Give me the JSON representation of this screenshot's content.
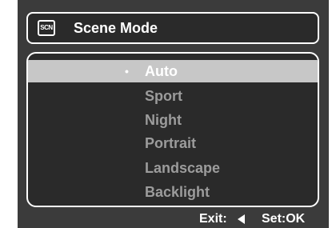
{
  "header": {
    "icon_text": "SCN",
    "title": "Scene Mode"
  },
  "menu": {
    "selected_index": 0,
    "bullet": "•",
    "items": [
      {
        "label": "Auto"
      },
      {
        "label": "Sport"
      },
      {
        "label": "Night"
      },
      {
        "label": "Portrait"
      },
      {
        "label": "Landscape"
      },
      {
        "label": "Backlight"
      }
    ]
  },
  "footer": {
    "exit_label": "Exit:",
    "set_label": "Set:OK"
  },
  "colors": {
    "screen_bg": "#3b3b3b",
    "panel_bg": "#2a2a2a",
    "highlight": "#c7c7c7",
    "text_active": "#ffffff",
    "text_inactive": "#9c9c9c"
  },
  "icons": {
    "scene": "scn-icon",
    "exit": "left-arrow-icon"
  }
}
